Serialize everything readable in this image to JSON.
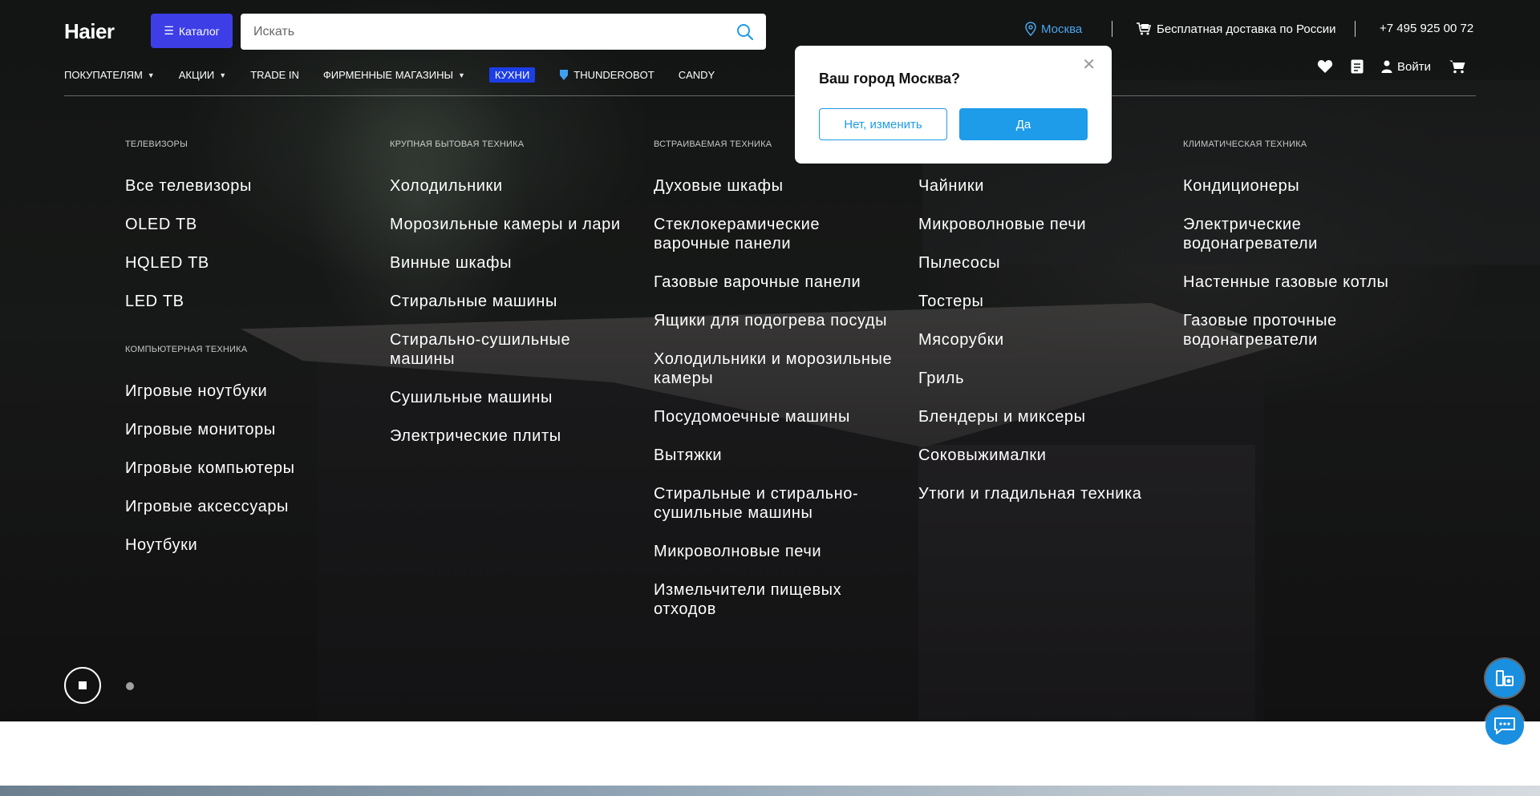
{
  "header": {
    "logo": "Haier",
    "catalog_label": "Каталог",
    "search_placeholder": "Искать",
    "city": "Москва",
    "delivery": "Бесплатная доставка по России",
    "phone": "+7 495 925 00 72",
    "login": "Войти"
  },
  "nav": {
    "items": [
      {
        "label": "ПОКУПАТЕЛЯМ"
      },
      {
        "label": "АКЦИИ"
      },
      {
        "label": "TRADE IN"
      },
      {
        "label": "ФИРМЕННЫЕ МАГАЗИНЫ"
      },
      {
        "label": "КУХНИ"
      },
      {
        "label": "THUNDEROBOT"
      },
      {
        "label": "CANDY"
      }
    ]
  },
  "menu": {
    "columns": [
      {
        "heading": "ТЕЛЕВИЗОРЫ",
        "links": [
          "Все телевизоры",
          "OLED ТВ",
          "HQLED ТВ",
          "LED ТВ"
        ],
        "heading2": "КОМПЬЮТЕРНАЯ ТЕХНИКА",
        "links2": [
          "Игровые ноутбуки",
          "Игровые мониторы",
          "Игровые компьютеры",
          "Игровые аксессуары",
          "Ноутбуки"
        ]
      },
      {
        "heading": "КРУПНАЯ БЫТОВАЯ ТЕХНИКА",
        "links": [
          "Холодильники",
          "Морозильные камеры и лари",
          "Винные шкафы",
          "Стиральные машины",
          "Стирально-сушильные машины",
          "Сушильные машины",
          "Электрические плиты"
        ]
      },
      {
        "heading": "ВСТРАИВАЕМАЯ ТЕХНИКА",
        "links": [
          "Духовые шкафы",
          "Стеклокерамические варочные панели",
          "Газовые варочные панели",
          "Ящики для подогрева посуды",
          "Холодильники и морозильные камеры",
          "Посудомоечные машины",
          "Вытяжки",
          "Стиральные и стирально-сушильные машины",
          "Микроволновые печи",
          "Измельчители пищевых отходов"
        ]
      },
      {
        "heading": "",
        "links": [
          "Чайники",
          "Микроволновые печи",
          "Пылесосы",
          "Тостеры",
          "Мясорубки",
          "Гриль",
          "Блендеры и миксеры",
          "Соковыжималки",
          "Утюги и гладильная техника"
        ]
      },
      {
        "heading": "КЛИМАТИЧЕСКАЯ ТЕХНИКА",
        "links": [
          "Кондиционеры",
          "Электрические водонагреватели",
          "Настенные газовые котлы",
          "Газовые проточные водонагреватели"
        ]
      }
    ]
  },
  "popup": {
    "title": "Ваш город Москва?",
    "no_label": "Нет, изменить",
    "yes_label": "Да"
  },
  "colors": {
    "catalog_bg": "#3d3ee6",
    "accent": "#1e9be9",
    "kitchen_badge": "#1c3ee6"
  }
}
